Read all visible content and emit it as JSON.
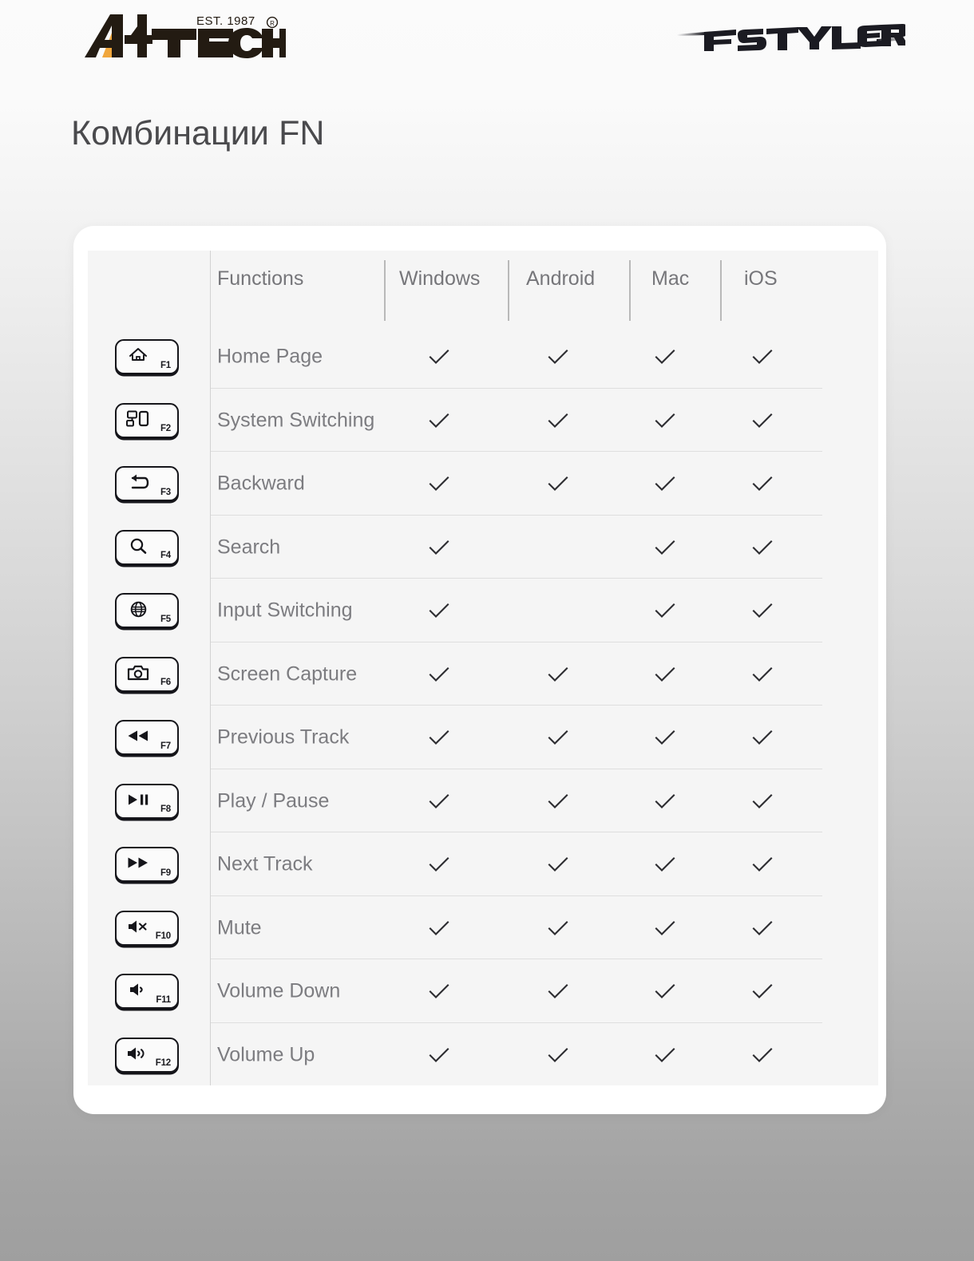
{
  "header": {
    "brand_logo": "a4tech-logo",
    "brand_text": "A4TECH",
    "brand_established": "EST. 1987",
    "brand_trademark": "®",
    "product_logo": "fstyler-logo",
    "product_text": "FSTYLER"
  },
  "page_title": "Комбинации FN",
  "table": {
    "columns": [
      "Functions",
      "Windows",
      "Android",
      "Mac",
      "iOS"
    ],
    "check_glyph": "check-icon",
    "rows": [
      {
        "key": "F1",
        "icon": "home-icon",
        "function": "Home Page",
        "windows": true,
        "android": true,
        "mac": true,
        "ios": true
      },
      {
        "key": "F2",
        "icon": "devices-switch-icon",
        "function": "System Switching",
        "windows": true,
        "android": true,
        "mac": true,
        "ios": true
      },
      {
        "key": "F3",
        "icon": "back-arrow-icon",
        "function": "Backward",
        "windows": true,
        "android": true,
        "mac": true,
        "ios": true
      },
      {
        "key": "F4",
        "icon": "search-icon",
        "function": "Search",
        "windows": true,
        "android": false,
        "mac": true,
        "ios": true
      },
      {
        "key": "F5",
        "icon": "globe-icon",
        "function": "Input Switching",
        "windows": true,
        "android": false,
        "mac": true,
        "ios": true
      },
      {
        "key": "F6",
        "icon": "camera-icon",
        "function": "Screen Capture",
        "windows": true,
        "android": true,
        "mac": true,
        "ios": true
      },
      {
        "key": "F7",
        "icon": "rewind-icon",
        "function": "Previous Track",
        "windows": true,
        "android": true,
        "mac": true,
        "ios": true
      },
      {
        "key": "F8",
        "icon": "play-pause-icon",
        "function": "Play / Pause",
        "windows": true,
        "android": true,
        "mac": true,
        "ios": true
      },
      {
        "key": "F9",
        "icon": "fast-forward-icon",
        "function": "Next Track",
        "windows": true,
        "android": true,
        "mac": true,
        "ios": true
      },
      {
        "key": "F10",
        "icon": "mute-icon",
        "function": "Mute",
        "windows": true,
        "android": true,
        "mac": true,
        "ios": true
      },
      {
        "key": "F11",
        "icon": "volume-down-icon",
        "function": "Volume Down",
        "windows": true,
        "android": true,
        "mac": true,
        "ios": true
      },
      {
        "key": "F12",
        "icon": "volume-up-icon",
        "function": "Volume Up",
        "windows": true,
        "android": true,
        "mac": true,
        "ios": true
      }
    ]
  },
  "colors": {
    "title_text": "#4a4a4d",
    "header_text": "#76767a",
    "body_text": "#7c7c80",
    "keycap_outline": "#15151a",
    "check_stroke": "#2c2c30",
    "panel_bg": "#f5f5f5",
    "card_bg": "#ffffff",
    "brand_accent": "#f0a63c"
  }
}
